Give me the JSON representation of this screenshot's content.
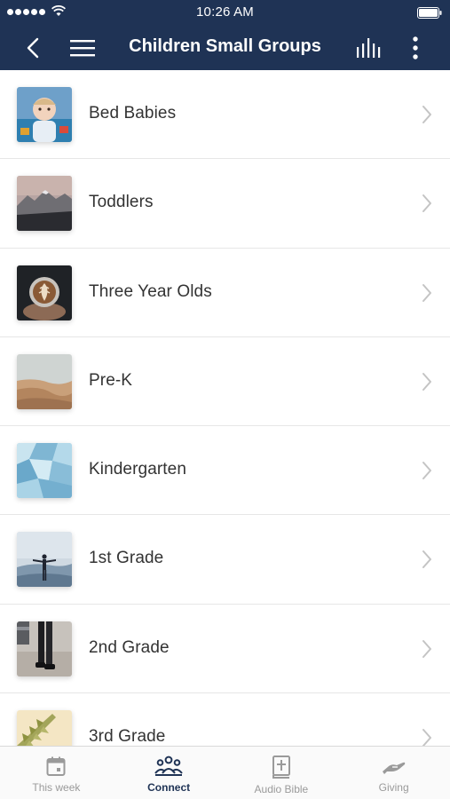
{
  "status_bar": {
    "time": "10:26 AM"
  },
  "nav": {
    "title": "Children Small Groups"
  },
  "groups": [
    {
      "label": "Bed Babies"
    },
    {
      "label": "Toddlers"
    },
    {
      "label": "Three Year Olds"
    },
    {
      "label": "Pre-K"
    },
    {
      "label": "Kindergarten"
    },
    {
      "label": "1st Grade"
    },
    {
      "label": "2nd Grade"
    },
    {
      "label": "3rd Grade"
    }
  ],
  "tabs": [
    {
      "label": "This week",
      "icon": "calendar-icon",
      "active": false
    },
    {
      "label": "Connect",
      "icon": "people-icon",
      "active": true
    },
    {
      "label": "Audio Bible",
      "icon": "bible-icon",
      "active": false
    },
    {
      "label": "Giving",
      "icon": "hand-icon",
      "active": false
    }
  ],
  "colors": {
    "header": "#1f3355",
    "active_tab": "#1f3355",
    "inactive_tab": "#9a9a9a"
  }
}
